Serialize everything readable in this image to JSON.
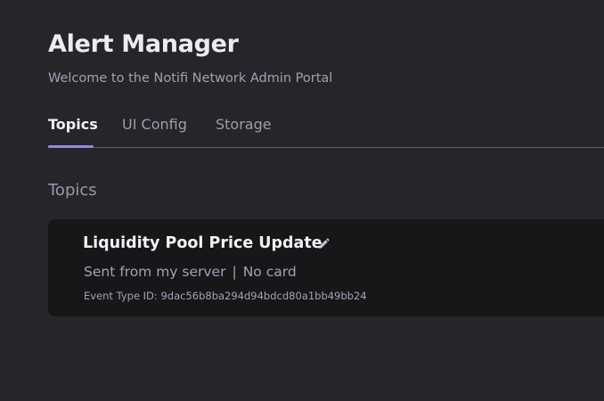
{
  "header": {
    "title": "Alert Manager",
    "subtitle": "Welcome to the Notifi Network Admin Portal"
  },
  "tabs": [
    {
      "label": "Topics",
      "active": true
    },
    {
      "label": "UI Config",
      "active": false
    },
    {
      "label": "Storage",
      "active": false
    }
  ],
  "section": {
    "heading": "Topics"
  },
  "topic_card": {
    "title": "Liquidity Pool Price Update",
    "source": "Sent from my server",
    "separator": "|",
    "card_status": "No card",
    "event_type_label": "Event Type ID:",
    "event_type_id": "9dac56b8ba294d94bdcd80a1bb49bb24",
    "edit_icon": "pencil-icon"
  },
  "colors": {
    "background": "#262529",
    "card_background": "#171719",
    "accent": "#8c87ff",
    "primary_text": "#f1f0f6",
    "secondary_text": "#a2a0b4"
  }
}
